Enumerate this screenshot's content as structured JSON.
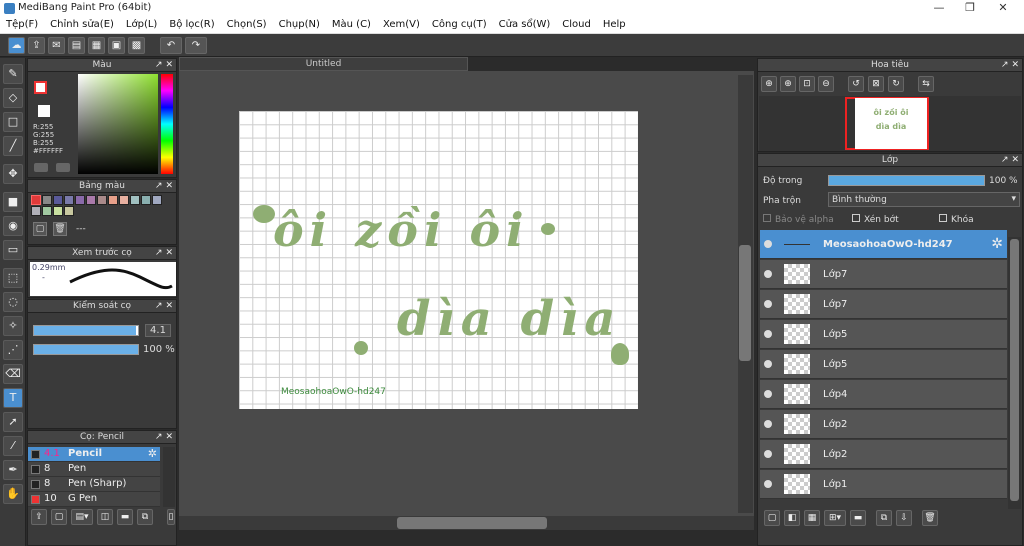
{
  "window": {
    "title": "MediBang Paint Pro (64bit)",
    "min": "—",
    "max": "❐",
    "close": "✕"
  },
  "menu": [
    "Tệp(F)",
    "Chỉnh sửa(E)",
    "Lớp(L)",
    "Bộ lọc(R)",
    "Chọn(S)",
    "Chụp(N)",
    "Màu (C)",
    "Xem(V)",
    "Công cụ(T)",
    "Cửa sổ(W)",
    "Cloud",
    "Help"
  ],
  "color_panel": {
    "title": "Màu",
    "r": "R:255",
    "g": "G:255",
    "b": "B:255",
    "hex": "#FFFFFF"
  },
  "palette_panel": {
    "title": "Bảng màu",
    "dash": "---",
    "swatches": [
      "#e03a3a",
      "#888",
      "#5a5a9a",
      "#7a7aaa",
      "#8a6aaa",
      "#aa7aaa",
      "#aa8a8a",
      "#e8a08a",
      "#e8b0a0",
      "#a0c0c0",
      "#8ab0b0",
      "#a0a8c0",
      "#b0b0b8",
      "#a0c8a0",
      "#c8e0a0",
      "#c8c8a0"
    ]
  },
  "brush_preview": {
    "title": "Xem trước cọ",
    "size": "0.29mm",
    "dash": "-"
  },
  "brush_control": {
    "title": "Kiểm soát cọ",
    "size": "4.1",
    "opacity": "100 %",
    "size_fraction": 0.98,
    "opacity_fraction": 1.0
  },
  "brush_panel": {
    "title": "Cọ: Pencil",
    "items": [
      {
        "size": "4.1",
        "name": "Pencil",
        "color": "#222"
      },
      {
        "size": "8",
        "name": "Pen",
        "color": "#222"
      },
      {
        "size": "8",
        "name": "Pen (Sharp)",
        "color": "#222"
      },
      {
        "size": "10",
        "name": "G Pen",
        "color": "#e33"
      }
    ]
  },
  "document": {
    "tab": "Untitled",
    "art_line1": "ôi zồi ôi",
    "art_line2": "dìa dìa",
    "watermark": "MeosaohoaOwO-hd247"
  },
  "navigator": {
    "title": "Hoa tiêu"
  },
  "layers_panel": {
    "title": "Lớp",
    "opacity_label": "Độ trong",
    "opacity_value": "100 %",
    "opacity_fraction": 1.0,
    "blend_label": "Pha trộn",
    "blend_value": "Bình thường",
    "protect_alpha": "Bảo vệ alpha",
    "clipping": "Xén bớt",
    "lock": "Khóa",
    "layers": [
      "MeosaohoaOwO-hd247",
      "Lớp7",
      "Lớp7",
      "Lớp5",
      "Lớp5",
      "Lớp4",
      "Lớp2",
      "Lớp2",
      "Lớp1"
    ]
  }
}
